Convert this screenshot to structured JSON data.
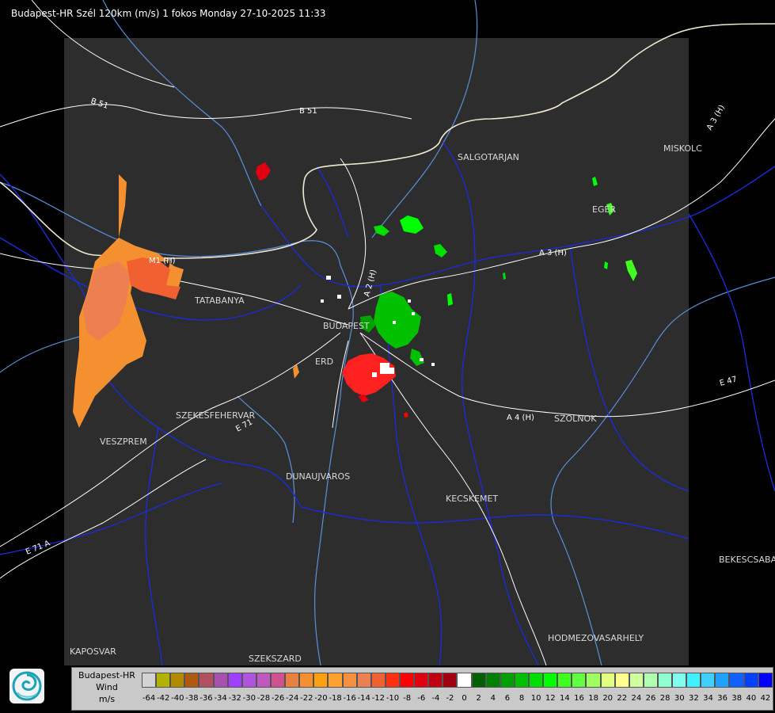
{
  "title": "Budapest-HR Szél 120km (m/s) 1 fokos Monday 27-10-2025 11:33",
  "cities": [
    {
      "id": "salgotarjan",
      "label": "SALGOTARJAN"
    },
    {
      "id": "miskolc",
      "label": "MISKOLC"
    },
    {
      "id": "eger",
      "label": "EGER"
    },
    {
      "id": "tatabanya",
      "label": "TATABANYA"
    },
    {
      "id": "budapest",
      "label": "BUDAPEST"
    },
    {
      "id": "erd",
      "label": "ERD"
    },
    {
      "id": "szekesfehervar",
      "label": "SZEKESFEHERVAR"
    },
    {
      "id": "veszprem",
      "label": "VESZPREM"
    },
    {
      "id": "dunaujvaros",
      "label": "DUNAUJVAROS"
    },
    {
      "id": "kecskemet",
      "label": "KECSKEMET"
    },
    {
      "id": "szolnok",
      "label": "SZOLNOK"
    },
    {
      "id": "bekescsaba",
      "label": "BEKESCSABA"
    },
    {
      "id": "hodmezovasarhely",
      "label": "HODMEZOVASARHELY"
    },
    {
      "id": "kaposvar",
      "label": "KAPOSVAR"
    },
    {
      "id": "szekszard",
      "label": "SZEKSZARD"
    }
  ],
  "roads": [
    {
      "id": "b51-west",
      "label": "B 51"
    },
    {
      "id": "b51-north",
      "label": "B 51"
    },
    {
      "id": "a3-east",
      "label": "A 3 (H)"
    },
    {
      "id": "a3-northeast",
      "label": "A 3 (H)"
    },
    {
      "id": "a2",
      "label": "A 2 (H)"
    },
    {
      "id": "a4",
      "label": "A 4 (H)"
    },
    {
      "id": "e71",
      "label": "E 71"
    },
    {
      "id": "e71-south",
      "label": "E 71 A"
    },
    {
      "id": "e47",
      "label": "E 47"
    },
    {
      "id": "m1",
      "label": "M1 (H)"
    }
  ],
  "legend": {
    "station": "Budapest-HR",
    "product": "Wind",
    "unit": "m/s",
    "ticks": [
      "-64",
      "-42",
      "-40",
      "-38",
      "-36",
      "-34",
      "-32",
      "-30",
      "-28",
      "-26",
      "-24",
      "-22",
      "-20",
      "-18",
      "-16",
      "-14",
      "-12",
      "-10",
      "-8",
      "-6",
      "-4",
      "-2",
      "0",
      "2",
      "4",
      "6",
      "8",
      "10",
      "12",
      "14",
      "16",
      "18",
      "20",
      "22",
      "24",
      "26",
      "28",
      "30",
      "32",
      "34",
      "36",
      "38",
      "40",
      "42"
    ],
    "colors": [
      "#d3d3d3",
      "#b2b200",
      "#b28a00",
      "#b05a10",
      "#b05060",
      "#a84fb0",
      "#a040ff",
      "#b054e0",
      "#c058c0",
      "#d05090",
      "#e88040",
      "#f59030",
      "#ffa010",
      "#ffa030",
      "#f59040",
      "#ec8050",
      "#f06030",
      "#ff3010",
      "#ff0000",
      "#e00010",
      "#c00010",
      "#a00010",
      "#ffffff",
      "#006000",
      "#008000",
      "#00a000",
      "#00c000",
      "#00e000",
      "#00ff00",
      "#40ff20",
      "#60ff40",
      "#a0ff60",
      "#e0ff80",
      "#ffff90",
      "#d0ffa0",
      "#b0ffb0",
      "#90ffd0",
      "#80fff0",
      "#40f0ff",
      "#40d0ff",
      "#20a0ff",
      "#1060ff",
      "#0040ff",
      "#0000ff"
    ]
  },
  "colors": {
    "background": "#000000",
    "radar_area": "#2d2d2d",
    "county_border": "#1c2bd6",
    "river": "#5a8fd9",
    "road": "#ffffff",
    "approaching": "#ff2020",
    "receding": "#20e020",
    "far_west_echo": "#f59030"
  }
}
